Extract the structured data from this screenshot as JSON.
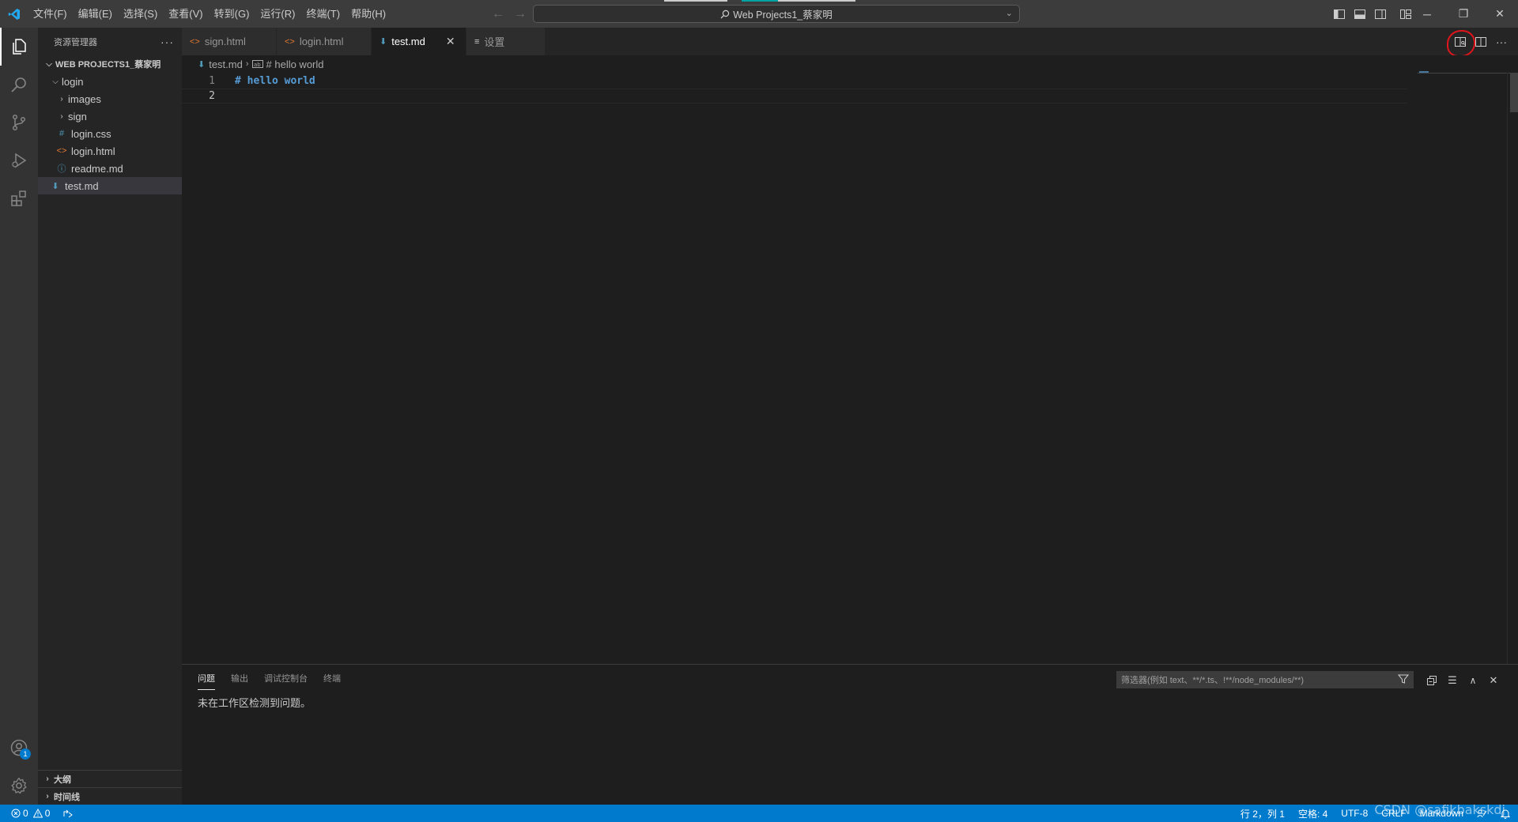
{
  "titlebar": {
    "menus": [
      "文件(F)",
      "编辑(E)",
      "选择(S)",
      "查看(V)",
      "转到(G)",
      "运行(R)",
      "终端(T)",
      "帮助(H)"
    ],
    "command_center": "Web Projects1_蔡家明",
    "app_logo": "vscode-logo"
  },
  "sidebar": {
    "title": "资源管理器",
    "root": "WEB PROJECTS1_蔡家明",
    "tree": [
      {
        "label": "login",
        "kind": "folder-open",
        "depth": 1
      },
      {
        "label": "images",
        "kind": "folder",
        "depth": 2
      },
      {
        "label": "sign",
        "kind": "folder",
        "depth": 2
      },
      {
        "label": "login.css",
        "kind": "css",
        "icon": "#",
        "depth": 2
      },
      {
        "label": "login.html",
        "kind": "html",
        "icon": "<>",
        "depth": 2
      },
      {
        "label": "readme.md",
        "kind": "info",
        "icon": "ⓘ",
        "depth": 2
      },
      {
        "label": "test.md",
        "kind": "markdown",
        "icon": "⬇",
        "depth": 1,
        "selected": true
      }
    ],
    "sections": [
      "大纲",
      "时间线"
    ]
  },
  "tabs": [
    {
      "label": "sign.html",
      "icon": "<>",
      "color": "#e37933"
    },
    {
      "label": "login.html",
      "icon": "<>",
      "color": "#e37933"
    },
    {
      "label": "test.md",
      "icon": "⬇",
      "color": "#519aba",
      "active": true,
      "close": "✕"
    },
    {
      "label": "设置",
      "icon": "≡",
      "color": "#cccccc"
    }
  ],
  "breadcrumbs": {
    "file": "test.md",
    "symbol": "# hello world"
  },
  "editor": {
    "lines": [
      {
        "number": "1",
        "text": "# hello world"
      },
      {
        "number": "2",
        "text": ""
      }
    ],
    "current_line": 2
  },
  "panel": {
    "tabs": [
      "问题",
      "输出",
      "调试控制台",
      "终端"
    ],
    "active_tab": "问题",
    "filter_placeholder": "筛选器(例如 text、**/*.ts、!**/node_modules/**)",
    "message": "未在工作区检测到问题。"
  },
  "statusbar": {
    "errors": "0",
    "warnings": "0",
    "position": "行 2，列 1",
    "spaces": "空格: 4",
    "encoding": "UTF-8",
    "eol": "CRLF",
    "language": "Markdown"
  },
  "accounts_badge": "1",
  "watermark": "CSDN @safikbakskdj",
  "colors": {
    "accent": "#007acc",
    "highlight_circle": "#e0151b",
    "html_icon": "#e37933",
    "css_icon": "#519aba",
    "markdown_heading": "#569cd6"
  }
}
